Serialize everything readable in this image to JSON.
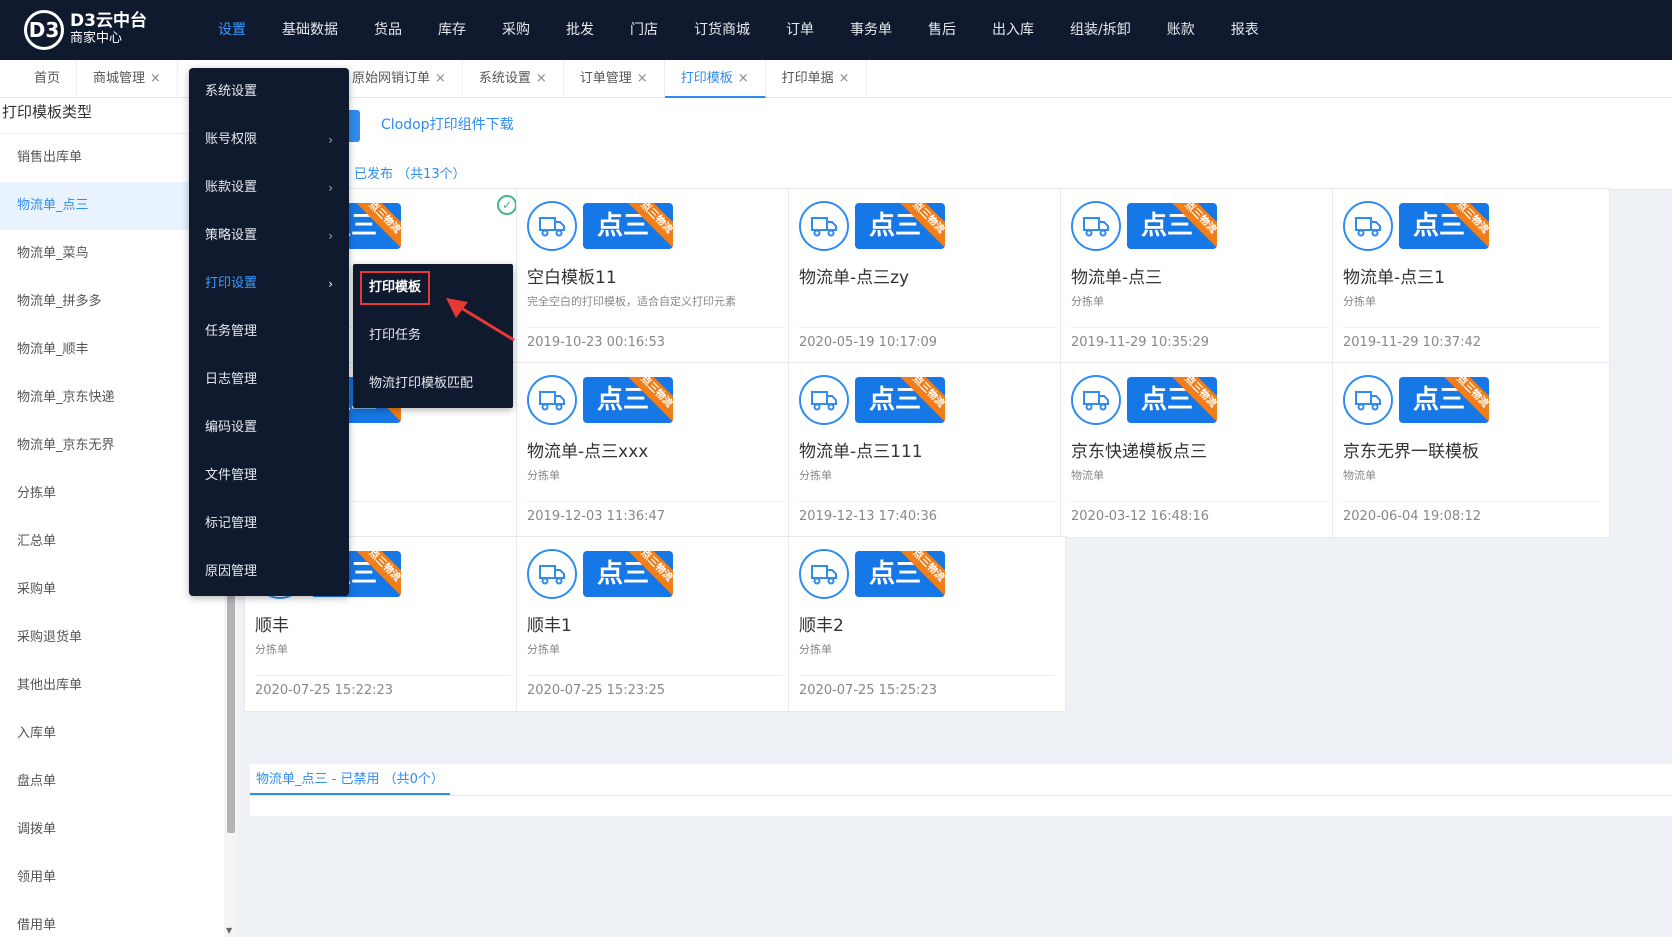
{
  "app": {
    "logo_mark": "D3",
    "brand_line1": "D3云中台",
    "brand_line2": "商家中心"
  },
  "nav": [
    "设置",
    "基础数据",
    "货品",
    "库存",
    "采购",
    "批发",
    "门店",
    "订货商城",
    "订单",
    "事务单",
    "售后",
    "出入库",
    "组装/拆卸",
    "账款",
    "报表"
  ],
  "nav_active": 0,
  "tabs": [
    {
      "label": "首页",
      "closable": false
    },
    {
      "label": "商城管理",
      "closable": true
    },
    {
      "label": "原始网销订单",
      "closable": true
    },
    {
      "label": "系统设置",
      "closable": true
    },
    {
      "label": "订单管理",
      "closable": true
    },
    {
      "label": "打印模板",
      "closable": true,
      "active": true
    },
    {
      "label": "打印单据",
      "closable": true
    }
  ],
  "sidebar": {
    "title": "打印模板类型",
    "items": [
      "销售出库单",
      "物流单_点三",
      "物流单_菜鸟",
      "物流单_拼多多",
      "物流单_顺丰",
      "物流单_京东快递",
      "物流单_京东无界",
      "分拣单",
      "汇总单",
      "采购单",
      "采购退货单",
      "其他出库单",
      "入库单",
      "盘点单",
      "调拨单",
      "领用单",
      "借用单"
    ],
    "active_index": 1
  },
  "main": {
    "clodop_link": "Clodop打印组件下载",
    "published_header": "已发布 （共13个）",
    "disabled_header": "物流单_点三 - 已禁用 （共0个）",
    "badge_text": "点三",
    "ribbon_text": "点三物流",
    "cards": [
      {
        "title": "",
        "subtitle": "",
        "date": "",
        "default": true
      },
      {
        "title": "空白模板11",
        "subtitle": "完全空白的打印模板，适合自定义打印元素",
        "date": "2019-10-23 00:16:53"
      },
      {
        "title": "物流单-点三zy",
        "subtitle": "",
        "date": "2020-05-19 10:17:09"
      },
      {
        "title": "物流单-点三",
        "subtitle": "分拣单",
        "date": "2019-11-29 10:35:29"
      },
      {
        "title": "物流单-点三1",
        "subtitle": "分拣单",
        "date": "2019-11-29 10:37:42"
      },
      {
        "title": "三11",
        "subtitle": "",
        "date": "10:38:02"
      },
      {
        "title": "物流单-点三xxx",
        "subtitle": "分拣单",
        "date": "2019-12-03 11:36:47"
      },
      {
        "title": "物流单-点三111",
        "subtitle": "分拣单",
        "date": "2019-12-13 17:40:36"
      },
      {
        "title": "京东快递模板点三",
        "subtitle": "物流单",
        "date": "2020-03-12 16:48:16"
      },
      {
        "title": "京东无界一联模板",
        "subtitle": "物流单",
        "date": "2020-06-04 19:08:12"
      },
      {
        "title": "顺丰",
        "subtitle": "分拣单",
        "date": "2020-07-25 15:22:23"
      },
      {
        "title": "顺丰1",
        "subtitle": "分拣单",
        "date": "2020-07-25 15:23:25"
      },
      {
        "title": "顺丰2",
        "subtitle": "分拣单",
        "date": "2020-07-25 15:25:23"
      }
    ]
  },
  "menu": {
    "items": [
      {
        "label": "系统设置",
        "has_sub": false
      },
      {
        "label": "账号权限",
        "has_sub": true
      },
      {
        "label": "账款设置",
        "has_sub": true
      },
      {
        "label": "策略设置",
        "has_sub": true
      },
      {
        "label": "打印设置",
        "has_sub": true,
        "active": true
      },
      {
        "label": "任务管理",
        "has_sub": false
      },
      {
        "label": "日志管理",
        "has_sub": false
      },
      {
        "label": "编码设置",
        "has_sub": false
      },
      {
        "label": "文件管理",
        "has_sub": false
      },
      {
        "label": "标记管理",
        "has_sub": false
      },
      {
        "label": "原因管理",
        "has_sub": false
      }
    ],
    "submenu": [
      "打印模板",
      "打印任务",
      "物流打印模板匹配"
    ],
    "submenu_highlight": 0
  },
  "colors": {
    "accent": "#2f8cf0",
    "nav_bg": "#0f1a2e",
    "ribbon": "#f07e1b",
    "highlight_border": "#e53935"
  }
}
